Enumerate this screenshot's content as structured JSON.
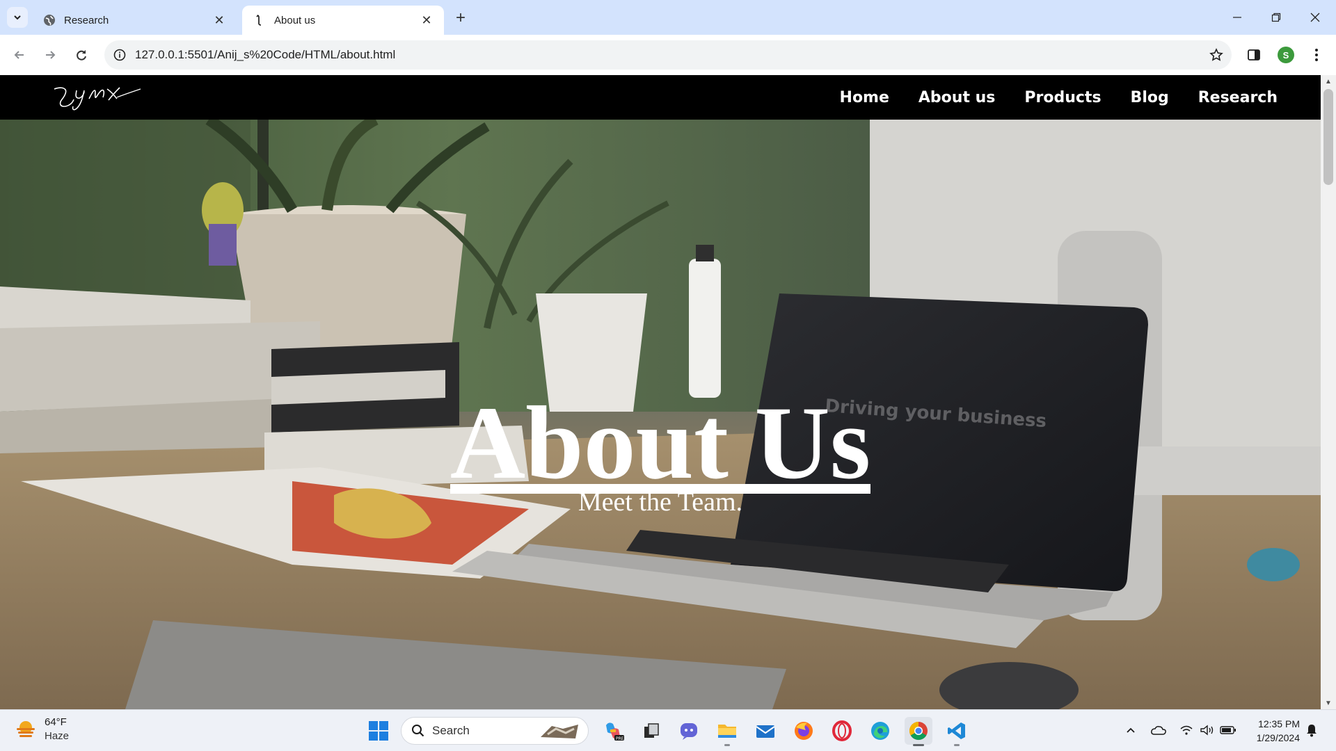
{
  "browser": {
    "tabs": [
      {
        "title": "Research",
        "icon": "globe-icon",
        "active": false
      },
      {
        "title": "About us",
        "icon": "lynx-favicon-icon",
        "active": true
      }
    ],
    "url": "127.0.0.1:5501/Anij_s%20Code/HTML/about.html",
    "profile_initial": "S"
  },
  "site": {
    "logo_text": "Lynx",
    "nav": [
      "Home",
      "About us",
      "Products",
      "Blog",
      "Research"
    ]
  },
  "hero": {
    "title": "About Us",
    "subtitle": "Meet the Team."
  },
  "taskbar": {
    "weather_temp": "64°F",
    "weather_cond": "Haze",
    "search_label": "Search",
    "time": "12:35 PM",
    "date": "1/29/2024",
    "apps": [
      "copilot-icon",
      "task-view-icon",
      "teams-icon",
      "file-explorer-icon",
      "mail-icon",
      "firefox-icon",
      "opera-icon",
      "edge-icon",
      "chrome-icon",
      "vscode-icon"
    ]
  },
  "colors": {
    "tabstrip_bg": "#d3e3fd",
    "site_nav_bg": "#000000",
    "hero_text": "#ffffff"
  }
}
